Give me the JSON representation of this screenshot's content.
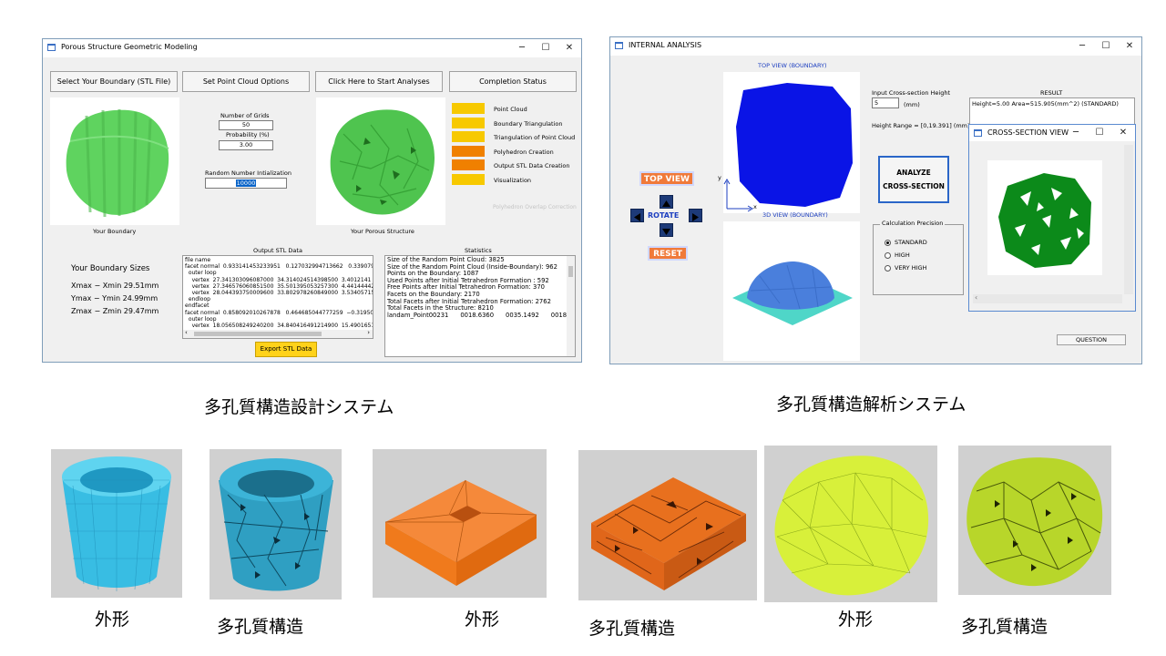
{
  "design_window": {
    "title": "Porous Structure Geometric Modeling",
    "controls": {
      "minimize": "─",
      "maximize": "☐",
      "close": "✕"
    },
    "buttons": {
      "select_boundary": "Select Your Boundary (STL File)",
      "point_cloud_options": "Set Point Cloud Options",
      "start_analyses": "Click Here to Start Analyses",
      "completion_status": "Completion Status"
    },
    "options": {
      "grids_label": "Number of Grids",
      "grids_value": "50",
      "probability_label": "Probability (%)",
      "probability_value": "3.00",
      "random_label": "Random Number Intialization",
      "random_value": "10000"
    },
    "status_items": [
      {
        "label": "Point Cloud",
        "color": "#f7c900"
      },
      {
        "label": "Boundary Triangulation",
        "color": "#f7c900"
      },
      {
        "label": "Triangulation of Point Cloud",
        "color": "#f7c900"
      },
      {
        "label": "Polyhedron Creation",
        "color": "#f08000"
      },
      {
        "label": "Output STL Data Creation",
        "color": "#f08000"
      },
      {
        "label": "Visualization",
        "color": "#f7c900"
      }
    ],
    "faint_label": "Polyhedron Overlap Correction",
    "boundary_caption": "Your Boundary",
    "porous_caption": "Your Porous Structure",
    "sizes": {
      "title": "Your Boundary Sizes",
      "x": "Xmax − Xmin  29.51mm",
      "y": "Ymax − Ymin  24.99mm",
      "z": "Zmax − Zmin  29.47mm"
    },
    "output_stl": {
      "label": "Output STL Data",
      "lines": [
        "file name",
        "facet normal  0.933141453233951   0.127032994713662   0.3390795325",
        "  outer loop",
        "    vertex  27.341303096087000  34.314024514398500  3.4012141 7791",
        "    vertex  27.346576060851500  35.501395053257300  4.44144442965",
        "    vertex  28.044393750009600  33.802978260849000  3.53405715089",
        "  endloop",
        "endfacet",
        "facet normal  0.858092010267878   0.464685044777259  −0.31950801 0",
        "  outer loop",
        "    vertex  18.056508249240200  34.840416491214900  15.4901651639"
      ]
    },
    "export_button": "Export STL Data",
    "statistics": {
      "label": "Statistics",
      "lines": [
        "Size of the Random Point Cloud: 3825",
        "Size of the Random Point Cloud (Inside-Boundary): 962",
        "",
        "Points on the Boundary: 1087",
        "Used Points after Initial Tetrahedron Formation : 592",
        "Free Points after Initial Tetrahedron Formation: 370",
        "",
        "Facets on the Boundary: 2170",
        "Total Facets after Initial Tetrahedron Formation: 2762",
        "Total Facets in the Structure: 8210",
        "",
        "landam_Point00231      0018.6360      0035.1492      0018.84"
      ]
    },
    "colors": {
      "boundary_green": "#5fd35f",
      "porous_green": "#4fc44f"
    }
  },
  "analysis_window": {
    "title": "INTERNAL ANALYSIS",
    "controls": {
      "minimize": "─",
      "maximize": "☐",
      "close": "✕"
    },
    "top_view_label": "TOP VIEW (BOUNDARY)",
    "view3d_label": "3D VIEW (BOUNDARY)",
    "buttons": {
      "top_view": "TOP VIEW",
      "rotate": "ROTATE",
      "reset": "RESET",
      "analyze_line1": "ANALYZE",
      "analyze_line2": "CROSS-SECTION",
      "question": "QUESTION"
    },
    "axis_x": "x",
    "axis_y": "y",
    "cross_section": {
      "height_label": "Input Cross-section Height",
      "height_value": "5",
      "unit": "(mm)",
      "range_label": "Height Range = [0,19.391] (mm)"
    },
    "result": {
      "label": "RESULT",
      "text": "Height=5.00    Area=515.905(mm^2) (STANDARD)"
    },
    "precision": {
      "label": "Calculation Precision",
      "options": [
        "STANDARD",
        "HIGH",
        "VERY HIGH"
      ],
      "selected": "STANDARD"
    },
    "popup": {
      "title": "CROSS-SECTION VIEW",
      "controls": {
        "minimize": "─",
        "maximize": "☐",
        "close": "✕"
      }
    },
    "colors": {
      "top_blue": "#0a14e6",
      "view3d_blue": "#4a7fdc",
      "base_teal": "#4fd6c8",
      "section_green": "#0c8a1a",
      "orange": "#f07a3a"
    }
  },
  "captions": {
    "design_system": "多孔質構造設計システム",
    "analysis_system": "多孔質構造解析システム"
  },
  "samples": [
    {
      "label": "外形",
      "color": "#38bde3"
    },
    {
      "label": "多孔質構造",
      "color": "#2f9fc2"
    },
    {
      "label": "外形",
      "color": "#f07a1c"
    },
    {
      "label": "多孔質構造",
      "color": "#e0661a"
    },
    {
      "label": "外形",
      "color": "#d8f03a"
    },
    {
      "label": "多孔質構造",
      "color": "#b8d62a"
    }
  ]
}
